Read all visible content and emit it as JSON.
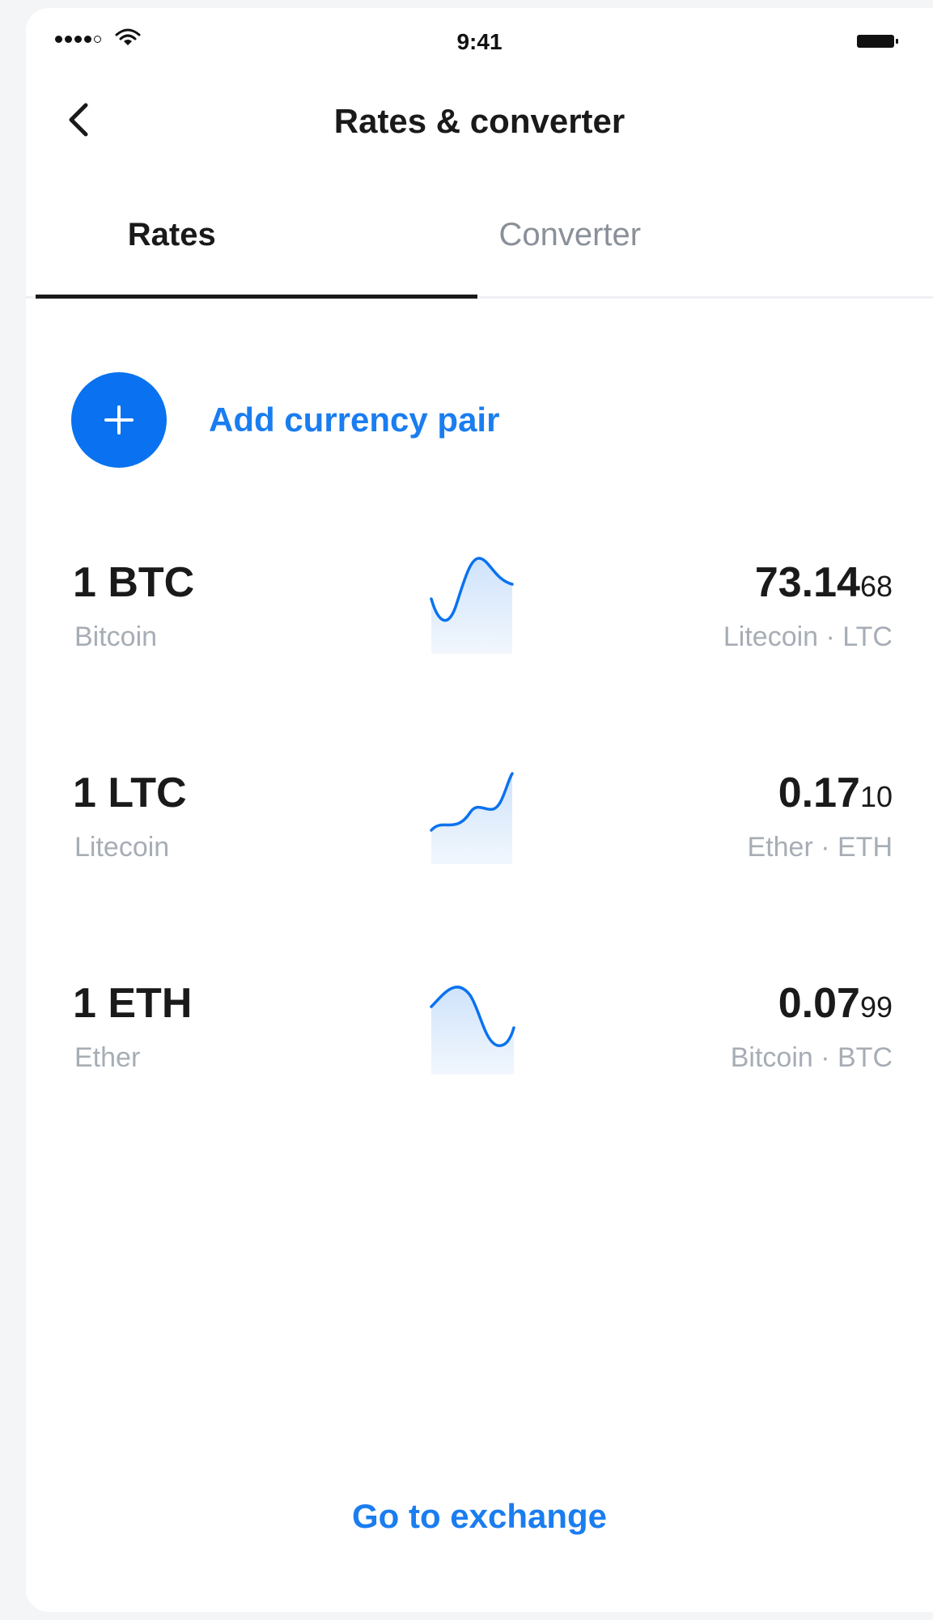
{
  "status_bar": {
    "time": "9:41"
  },
  "nav": {
    "title": "Rates & converter"
  },
  "tabs": [
    {
      "label": "Rates",
      "active": true
    },
    {
      "label": "Converter",
      "active": false
    }
  ],
  "add_pair": {
    "label": "Add currency pair"
  },
  "rates": [
    {
      "pair": "1 BTC",
      "name": "Bitcoin",
      "value_major": "73.14",
      "value_minor": "68",
      "target": "Litecoin · LTC"
    },
    {
      "pair": "1 LTC",
      "name": "Litecoin",
      "value_major": "0.17",
      "value_minor": "10",
      "target": "Ether · ETH"
    },
    {
      "pair": "1 ETH",
      "name": "Ether",
      "value_major": "0.07",
      "value_minor": "99",
      "target": "Bitcoin · BTC"
    }
  ],
  "footer": {
    "exchange_label": "Go to exchange"
  },
  "colors": {
    "accent": "#0a72f0",
    "text": "#1a1a1a",
    "muted": "#a7adb5"
  }
}
